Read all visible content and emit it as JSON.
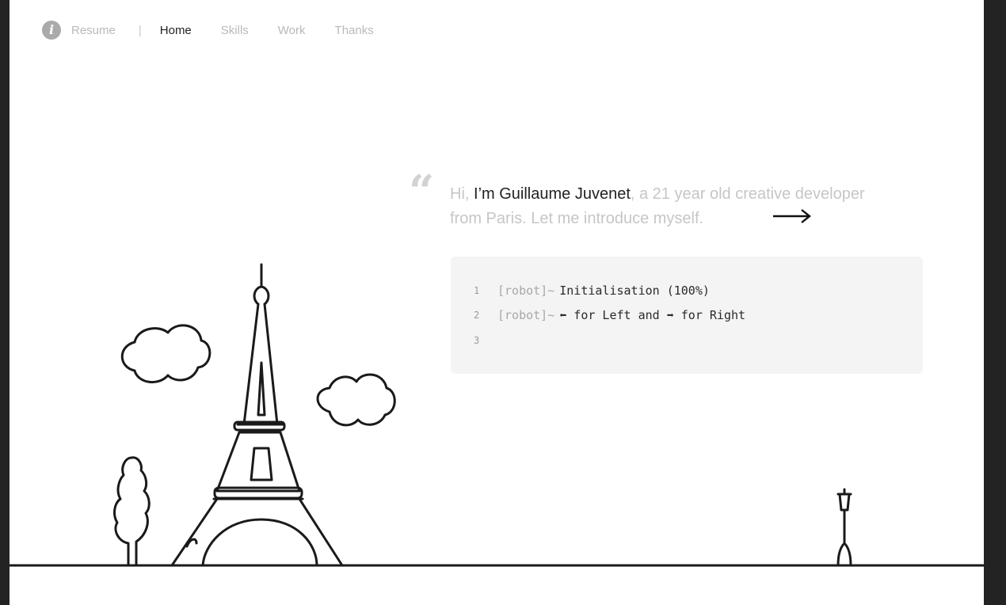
{
  "nav": {
    "info_icon": "info-icon",
    "resume": "Resume",
    "separator": "|",
    "items": [
      {
        "label": "Home",
        "active": true
      },
      {
        "label": "Skills",
        "active": false
      },
      {
        "label": "Work",
        "active": false
      },
      {
        "label": "Thanks",
        "active": false
      }
    ]
  },
  "intro": {
    "quote_mark": "“",
    "hi": "Hi",
    "comma": ",",
    "im": " I’m ",
    "name": "Guillaume Juvenet",
    "rest_line1": ", a 21 year old creative developer",
    "rest_line2": "from Paris. Let me introduce myself.",
    "arrow_icon": "arrow-right-icon"
  },
  "console": {
    "lines": [
      {
        "number": "1",
        "prompt": "[robot]~",
        "text": "Initialisation (100%)"
      },
      {
        "number": "2",
        "prompt": "[robot]~",
        "text": "⬅ for Left and ➡ for Right"
      },
      {
        "number": "3",
        "prompt": "",
        "text": ""
      }
    ]
  },
  "colors": {
    "background": "#ffffff",
    "frame": "#232323",
    "text_dark": "#222222",
    "text_light": "#c6c6c6",
    "console_bg": "#f4f4f4"
  }
}
